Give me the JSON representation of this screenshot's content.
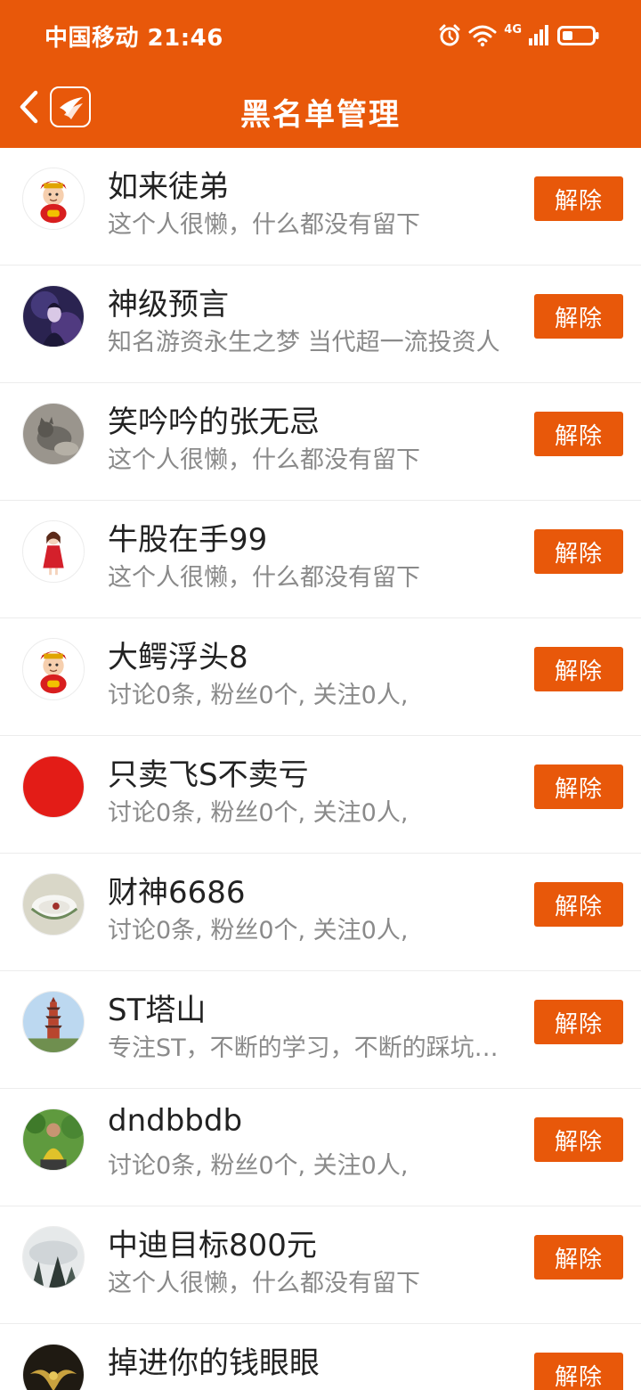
{
  "status_bar": {
    "carrier_time": "中国移动 21:46",
    "network": "4G"
  },
  "nav": {
    "title": "黑名单管理"
  },
  "colors": {
    "accent": "#E8580A",
    "name_text": "#222222",
    "desc_text": "#8a8a8a",
    "button_text": "#ffffff"
  },
  "blacklist": [
    {
      "name": "如来徒弟",
      "desc": "这个人很懒，什么都没有留下",
      "button": "解除",
      "avatar": "caishen-avatar-icon"
    },
    {
      "name": "神级预言",
      "desc": "知名游资永生之梦 当代超一流投资人",
      "button": "解除",
      "avatar": "night-figure-avatar"
    },
    {
      "name": "笑吟吟的张无忌",
      "desc": "这个人很懒，什么都没有留下",
      "button": "解除",
      "avatar": "gray-cat-avatar"
    },
    {
      "name": "牛股在手99",
      "desc": "这个人很懒，什么都没有留下",
      "button": "解除",
      "avatar": "red-dress-girl-avatar"
    },
    {
      "name": "大鳄浮头8",
      "desc": "讨论0条, 粉丝0个, 关注0人,",
      "button": "解除",
      "avatar": "caishen-avatar-icon"
    },
    {
      "name": "只卖飞S不卖亏",
      "desc": "讨论0条, 粉丝0个, 关注0人,",
      "button": "解除",
      "avatar": "red-circle-avatar"
    },
    {
      "name": "财神6686",
      "desc": "讨论0条, 粉丝0个, 关注0人,",
      "button": "解除",
      "avatar": "bowl-avatar"
    },
    {
      "name": "ST塔山",
      "desc": "专注ST，不断的学习，不断的踩坑中成长",
      "button": "解除",
      "avatar": "pagoda-avatar"
    },
    {
      "name": "dndbbdb",
      "desc": "讨论0条, 粉丝0个, 关注0人,",
      "button": "解除",
      "avatar": "person-outdoor-avatar"
    },
    {
      "name": "中迪目标800元",
      "desc": "这个人很懒，什么都没有留下",
      "button": "解除",
      "avatar": "misty-tree-avatar"
    },
    {
      "name": "掉进你的钱眼眼",
      "desc": "",
      "button": "解除",
      "avatar": "golden-emblem-avatar"
    }
  ]
}
